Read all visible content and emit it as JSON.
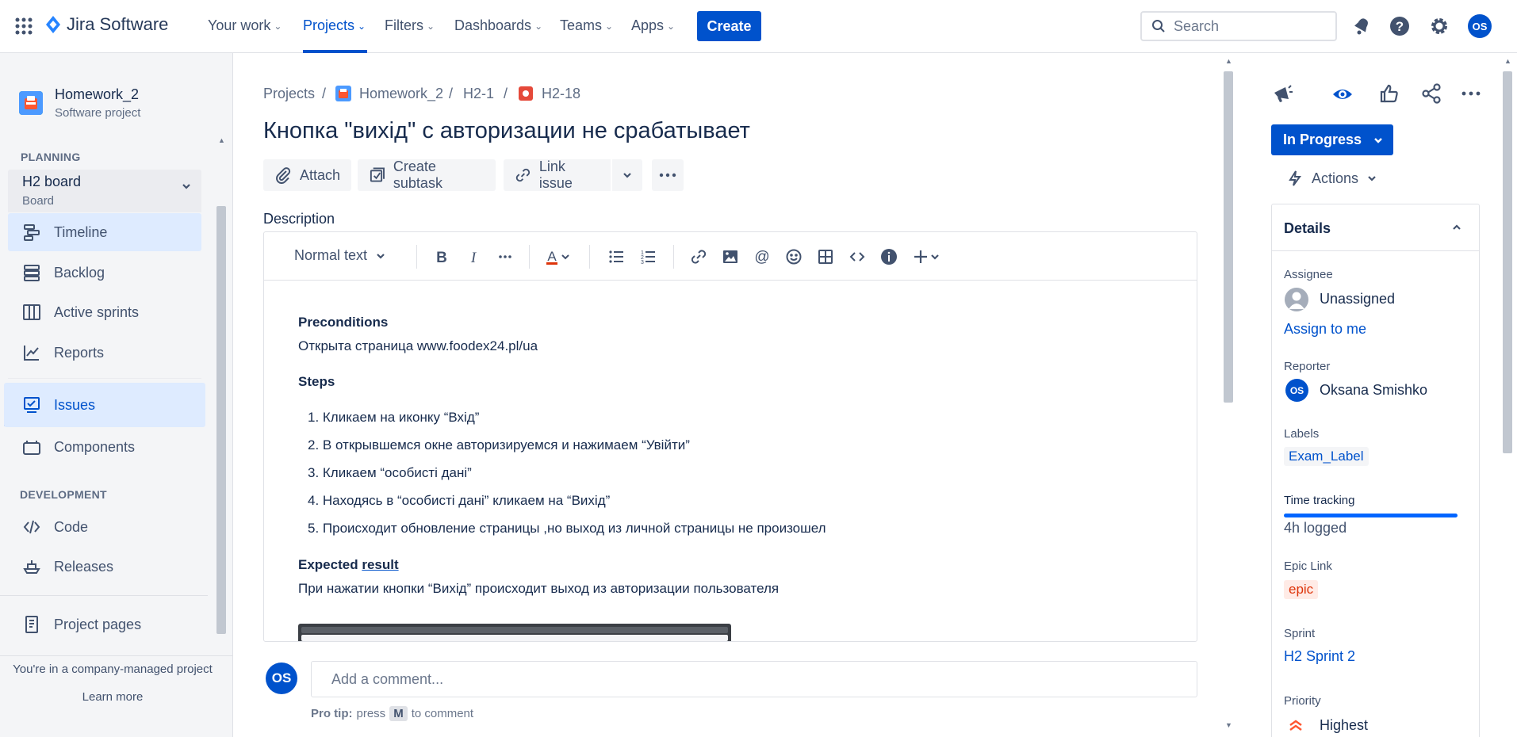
{
  "topnav": {
    "product": "Jira Software",
    "items": [
      {
        "label": "Your work"
      },
      {
        "label": "Projects"
      },
      {
        "label": "Filters"
      },
      {
        "label": "Dashboards"
      },
      {
        "label": "Teams"
      },
      {
        "label": "Apps"
      }
    ],
    "create_label": "Create",
    "search_placeholder": "Search",
    "user_initials": "OS"
  },
  "sidebar": {
    "project_name": "Homework_2",
    "project_type": "Software project",
    "planning_heading": "PLANNING",
    "board_name": "H2 board",
    "board_sub": "Board",
    "planning_items": [
      {
        "label": "Timeline",
        "icon": "timeline-icon"
      },
      {
        "label": "Backlog",
        "icon": "backlog-icon"
      },
      {
        "label": "Active sprints",
        "icon": "board-icon"
      },
      {
        "label": "Reports",
        "icon": "reports-icon"
      },
      {
        "label": "Issues",
        "icon": "issues-icon"
      },
      {
        "label": "Components",
        "icon": "components-icon"
      }
    ],
    "development_heading": "DEVELOPMENT",
    "dev_items": [
      {
        "label": "Code",
        "icon": "code-icon"
      },
      {
        "label": "Releases",
        "icon": "releases-icon"
      }
    ],
    "project_pages": "Project pages",
    "footer_text": "You're in a company-managed project",
    "learn_more": "Learn more"
  },
  "issue": {
    "breadcrumbs": [
      "Projects",
      "Homework_2",
      "H2-1",
      "H2-18"
    ],
    "title": "Кнопка \"вихід\" с авторизации не срабатывает",
    "toolbar": {
      "attach": "Attach",
      "create_subtask": "Create subtask",
      "link_issue": "Link issue"
    },
    "description_label": "Description",
    "editor": {
      "text_style": "Normal text"
    },
    "description": {
      "preconditions_heading": "Preconditions",
      "preconditions_text": "Открыта страница  www.foodex24.pl/ua",
      "steps_heading": "Steps",
      "steps": [
        "Кликаем на иконку “Вхід”",
        "В открывшемся окне авторизируемся и нажимаем “Увійти”",
        "Кликаем “особисті дані”",
        "Находясь в “особисті дані” кликаем на “Вихід”",
        "Происходит обновление страницы ,но выход из личной страницы не произошел"
      ],
      "expected_heading_a": "Expected",
      "expected_heading_b": "result",
      "expected_text": "При нажатии кнопки “Вихід” происходит выход из авторизации пользователя"
    },
    "comment": {
      "avatar": "OS",
      "placeholder": "Add a comment...",
      "tip_prefix": "Pro tip:",
      "tip_press": "press",
      "tip_key": "M",
      "tip_suffix": "to comment"
    }
  },
  "details": {
    "status": "In Progress",
    "actions": "Actions",
    "heading": "Details",
    "assignee_label": "Assignee",
    "assignee": "Unassigned",
    "assign_to_me": "Assign to me",
    "reporter_label": "Reporter",
    "reporter_initials": "OS",
    "reporter": "Oksana Smishko",
    "labels_label": "Labels",
    "label_value": "Exam_Label",
    "time_tracking_label": "Time tracking",
    "time_logged": "4h logged",
    "time_progress": 1.0,
    "epic_label": "Epic Link",
    "epic_value": "epic",
    "sprint_label": "Sprint",
    "sprint_value": "H2 Sprint 2",
    "priority_label": "Priority",
    "priority_value": "Highest"
  },
  "colors": {
    "brand": "#0052cc",
    "link": "#0052cc",
    "priority": "#ff5630",
    "epic_bg": "#ffebe6",
    "epic_text": "#de350b"
  }
}
